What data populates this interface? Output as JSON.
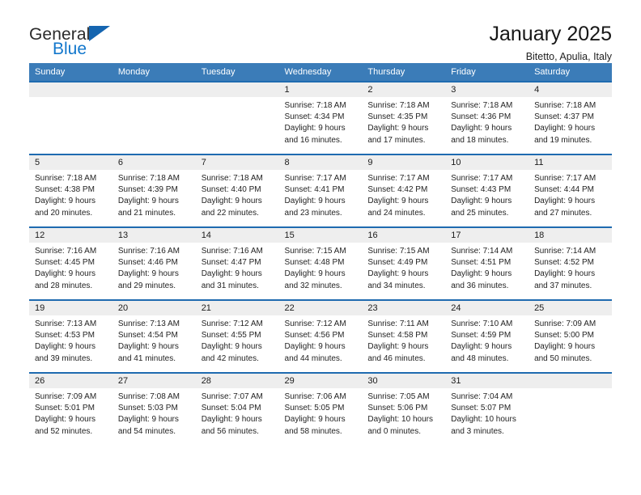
{
  "brand": {
    "name_part1": "General",
    "name_part2": "Blue",
    "logo_icon": "triangle-mark",
    "color_dark": "#2b2b2b",
    "color_blue": "#1277cc"
  },
  "header": {
    "title": "January 2025",
    "subtitle": "Bitetto, Apulia, Italy"
  },
  "theme": {
    "header_row_bg": "#3b7cb8",
    "row_divider": "#1f6bb0",
    "daynum_strip_bg": "#eeeeee"
  },
  "weekdays": [
    "Sunday",
    "Monday",
    "Tuesday",
    "Wednesday",
    "Thursday",
    "Friday",
    "Saturday"
  ],
  "weeks": [
    [
      {
        "day": "",
        "empty": true
      },
      {
        "day": "",
        "empty": true
      },
      {
        "day": "",
        "empty": true
      },
      {
        "day": "1",
        "sunrise": "Sunrise: 7:18 AM",
        "sunset": "Sunset: 4:34 PM",
        "daylight_line1": "Daylight: 9 hours",
        "daylight_line2": "and 16 minutes."
      },
      {
        "day": "2",
        "sunrise": "Sunrise: 7:18 AM",
        "sunset": "Sunset: 4:35 PM",
        "daylight_line1": "Daylight: 9 hours",
        "daylight_line2": "and 17 minutes."
      },
      {
        "day": "3",
        "sunrise": "Sunrise: 7:18 AM",
        "sunset": "Sunset: 4:36 PM",
        "daylight_line1": "Daylight: 9 hours",
        "daylight_line2": "and 18 minutes."
      },
      {
        "day": "4",
        "sunrise": "Sunrise: 7:18 AM",
        "sunset": "Sunset: 4:37 PM",
        "daylight_line1": "Daylight: 9 hours",
        "daylight_line2": "and 19 minutes."
      }
    ],
    [
      {
        "day": "5",
        "sunrise": "Sunrise: 7:18 AM",
        "sunset": "Sunset: 4:38 PM",
        "daylight_line1": "Daylight: 9 hours",
        "daylight_line2": "and 20 minutes."
      },
      {
        "day": "6",
        "sunrise": "Sunrise: 7:18 AM",
        "sunset": "Sunset: 4:39 PM",
        "daylight_line1": "Daylight: 9 hours",
        "daylight_line2": "and 21 minutes."
      },
      {
        "day": "7",
        "sunrise": "Sunrise: 7:18 AM",
        "sunset": "Sunset: 4:40 PM",
        "daylight_line1": "Daylight: 9 hours",
        "daylight_line2": "and 22 minutes."
      },
      {
        "day": "8",
        "sunrise": "Sunrise: 7:17 AM",
        "sunset": "Sunset: 4:41 PM",
        "daylight_line1": "Daylight: 9 hours",
        "daylight_line2": "and 23 minutes."
      },
      {
        "day": "9",
        "sunrise": "Sunrise: 7:17 AM",
        "sunset": "Sunset: 4:42 PM",
        "daylight_line1": "Daylight: 9 hours",
        "daylight_line2": "and 24 minutes."
      },
      {
        "day": "10",
        "sunrise": "Sunrise: 7:17 AM",
        "sunset": "Sunset: 4:43 PM",
        "daylight_line1": "Daylight: 9 hours",
        "daylight_line2": "and 25 minutes."
      },
      {
        "day": "11",
        "sunrise": "Sunrise: 7:17 AM",
        "sunset": "Sunset: 4:44 PM",
        "daylight_line1": "Daylight: 9 hours",
        "daylight_line2": "and 27 minutes."
      }
    ],
    [
      {
        "day": "12",
        "sunrise": "Sunrise: 7:16 AM",
        "sunset": "Sunset: 4:45 PM",
        "daylight_line1": "Daylight: 9 hours",
        "daylight_line2": "and 28 minutes."
      },
      {
        "day": "13",
        "sunrise": "Sunrise: 7:16 AM",
        "sunset": "Sunset: 4:46 PM",
        "daylight_line1": "Daylight: 9 hours",
        "daylight_line2": "and 29 minutes."
      },
      {
        "day": "14",
        "sunrise": "Sunrise: 7:16 AM",
        "sunset": "Sunset: 4:47 PM",
        "daylight_line1": "Daylight: 9 hours",
        "daylight_line2": "and 31 minutes."
      },
      {
        "day": "15",
        "sunrise": "Sunrise: 7:15 AM",
        "sunset": "Sunset: 4:48 PM",
        "daylight_line1": "Daylight: 9 hours",
        "daylight_line2": "and 32 minutes."
      },
      {
        "day": "16",
        "sunrise": "Sunrise: 7:15 AM",
        "sunset": "Sunset: 4:49 PM",
        "daylight_line1": "Daylight: 9 hours",
        "daylight_line2": "and 34 minutes."
      },
      {
        "day": "17",
        "sunrise": "Sunrise: 7:14 AM",
        "sunset": "Sunset: 4:51 PM",
        "daylight_line1": "Daylight: 9 hours",
        "daylight_line2": "and 36 minutes."
      },
      {
        "day": "18",
        "sunrise": "Sunrise: 7:14 AM",
        "sunset": "Sunset: 4:52 PM",
        "daylight_line1": "Daylight: 9 hours",
        "daylight_line2": "and 37 minutes."
      }
    ],
    [
      {
        "day": "19",
        "sunrise": "Sunrise: 7:13 AM",
        "sunset": "Sunset: 4:53 PM",
        "daylight_line1": "Daylight: 9 hours",
        "daylight_line2": "and 39 minutes."
      },
      {
        "day": "20",
        "sunrise": "Sunrise: 7:13 AM",
        "sunset": "Sunset: 4:54 PM",
        "daylight_line1": "Daylight: 9 hours",
        "daylight_line2": "and 41 minutes."
      },
      {
        "day": "21",
        "sunrise": "Sunrise: 7:12 AM",
        "sunset": "Sunset: 4:55 PM",
        "daylight_line1": "Daylight: 9 hours",
        "daylight_line2": "and 42 minutes."
      },
      {
        "day": "22",
        "sunrise": "Sunrise: 7:12 AM",
        "sunset": "Sunset: 4:56 PM",
        "daylight_line1": "Daylight: 9 hours",
        "daylight_line2": "and 44 minutes."
      },
      {
        "day": "23",
        "sunrise": "Sunrise: 7:11 AM",
        "sunset": "Sunset: 4:58 PM",
        "daylight_line1": "Daylight: 9 hours",
        "daylight_line2": "and 46 minutes."
      },
      {
        "day": "24",
        "sunrise": "Sunrise: 7:10 AM",
        "sunset": "Sunset: 4:59 PM",
        "daylight_line1": "Daylight: 9 hours",
        "daylight_line2": "and 48 minutes."
      },
      {
        "day": "25",
        "sunrise": "Sunrise: 7:09 AM",
        "sunset": "Sunset: 5:00 PM",
        "daylight_line1": "Daylight: 9 hours",
        "daylight_line2": "and 50 minutes."
      }
    ],
    [
      {
        "day": "26",
        "sunrise": "Sunrise: 7:09 AM",
        "sunset": "Sunset: 5:01 PM",
        "daylight_line1": "Daylight: 9 hours",
        "daylight_line2": "and 52 minutes."
      },
      {
        "day": "27",
        "sunrise": "Sunrise: 7:08 AM",
        "sunset": "Sunset: 5:03 PM",
        "daylight_line1": "Daylight: 9 hours",
        "daylight_line2": "and 54 minutes."
      },
      {
        "day": "28",
        "sunrise": "Sunrise: 7:07 AM",
        "sunset": "Sunset: 5:04 PM",
        "daylight_line1": "Daylight: 9 hours",
        "daylight_line2": "and 56 minutes."
      },
      {
        "day": "29",
        "sunrise": "Sunrise: 7:06 AM",
        "sunset": "Sunset: 5:05 PM",
        "daylight_line1": "Daylight: 9 hours",
        "daylight_line2": "and 58 minutes."
      },
      {
        "day": "30",
        "sunrise": "Sunrise: 7:05 AM",
        "sunset": "Sunset: 5:06 PM",
        "daylight_line1": "Daylight: 10 hours",
        "daylight_line2": "and 0 minutes."
      },
      {
        "day": "31",
        "sunrise": "Sunrise: 7:04 AM",
        "sunset": "Sunset: 5:07 PM",
        "daylight_line1": "Daylight: 10 hours",
        "daylight_line2": "and 3 minutes."
      },
      {
        "day": "",
        "empty": true
      }
    ]
  ]
}
